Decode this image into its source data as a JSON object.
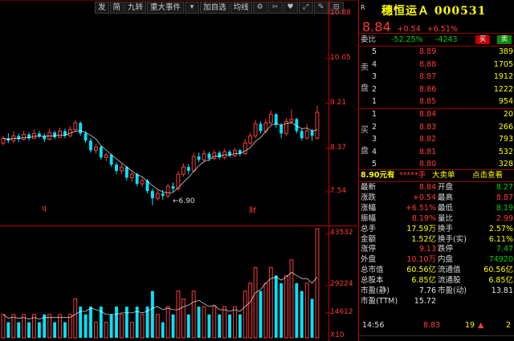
{
  "toolbar": {
    "items": [
      "发",
      "简",
      "九转",
      "重大事件",
      "▾",
      "加自选",
      "均线",
      "⚙",
      "✂",
      "♥",
      "⤢",
      "✎",
      "⊟"
    ]
  },
  "chart": {
    "price_axis": [
      "10.88",
      "10.05",
      "9.21",
      "8.37",
      "7.54"
    ],
    "volume_axis": [
      "43532",
      "29224",
      "14612",
      "X10"
    ],
    "low_marker": "6.90",
    "markers": [
      "q",
      "财"
    ],
    "colors": {
      "up": "#ff3b3b",
      "down": "#00e5ff",
      "ma": "#ffffff",
      "border": "#c00000"
    }
  },
  "chart_data": {
    "type": "candlestick",
    "ylim": [
      6.7,
      10.88
    ],
    "candles": [
      {
        "o": 8.2,
        "c": 8.3,
        "h": 8.35,
        "l": 8.15
      },
      {
        "o": 8.3,
        "c": 8.25,
        "h": 8.4,
        "l": 8.2
      },
      {
        "o": 8.25,
        "c": 8.35,
        "h": 8.45,
        "l": 8.2
      },
      {
        "o": 8.35,
        "c": 8.28,
        "h": 8.4,
        "l": 8.22
      },
      {
        "o": 8.28,
        "c": 8.38,
        "h": 8.45,
        "l": 8.25
      },
      {
        "o": 8.38,
        "c": 8.3,
        "h": 8.42,
        "l": 8.25
      },
      {
        "o": 8.3,
        "c": 8.4,
        "h": 8.48,
        "l": 8.28
      },
      {
        "o": 8.4,
        "c": 8.35,
        "h": 8.45,
        "l": 8.3
      },
      {
        "o": 8.35,
        "c": 8.28,
        "h": 8.4,
        "l": 8.22
      },
      {
        "o": 8.28,
        "c": 8.42,
        "h": 8.5,
        "l": 8.25
      },
      {
        "o": 8.42,
        "c": 8.32,
        "h": 8.46,
        "l": 8.28
      },
      {
        "o": 8.32,
        "c": 8.45,
        "h": 8.52,
        "l": 8.3
      },
      {
        "o": 8.45,
        "c": 8.35,
        "h": 8.5,
        "l": 8.3
      },
      {
        "o": 8.35,
        "c": 8.48,
        "h": 8.55,
        "l": 8.32
      },
      {
        "o": 8.48,
        "c": 8.62,
        "h": 8.68,
        "l": 8.45
      },
      {
        "o": 8.62,
        "c": 8.4,
        "h": 8.65,
        "l": 8.35
      },
      {
        "o": 8.4,
        "c": 8.25,
        "h": 8.45,
        "l": 8.2
      },
      {
        "o": 8.25,
        "c": 8.05,
        "h": 8.3,
        "l": 8.0
      },
      {
        "o": 8.05,
        "c": 8.12,
        "h": 8.18,
        "l": 7.98
      },
      {
        "o": 8.12,
        "c": 7.9,
        "h": 8.15,
        "l": 7.85
      },
      {
        "o": 7.9,
        "c": 7.95,
        "h": 8.0,
        "l": 7.82
      },
      {
        "o": 7.95,
        "c": 7.75,
        "h": 7.98,
        "l": 7.7
      },
      {
        "o": 7.75,
        "c": 7.62,
        "h": 7.8,
        "l": 7.55
      },
      {
        "o": 7.62,
        "c": 7.7,
        "h": 7.76,
        "l": 7.55
      },
      {
        "o": 7.7,
        "c": 7.48,
        "h": 7.72,
        "l": 7.42
      },
      {
        "o": 7.48,
        "c": 7.55,
        "h": 7.6,
        "l": 7.4
      },
      {
        "o": 7.55,
        "c": 7.35,
        "h": 7.58,
        "l": 7.3
      },
      {
        "o": 7.35,
        "c": 7.42,
        "h": 7.48,
        "l": 7.28
      },
      {
        "o": 7.42,
        "c": 7.2,
        "h": 7.45,
        "l": 7.15
      },
      {
        "o": 7.2,
        "c": 7.05,
        "h": 7.25,
        "l": 6.9
      },
      {
        "o": 7.05,
        "c": 7.15,
        "h": 7.22,
        "l": 7.0
      },
      {
        "o": 7.15,
        "c": 7.1,
        "h": 7.22,
        "l": 7.02
      },
      {
        "o": 7.1,
        "c": 7.3,
        "h": 7.35,
        "l": 7.05
      },
      {
        "o": 7.3,
        "c": 7.25,
        "h": 7.38,
        "l": 7.18
      },
      {
        "o": 7.25,
        "c": 7.55,
        "h": 7.62,
        "l": 7.2
      },
      {
        "o": 7.55,
        "c": 7.7,
        "h": 7.78,
        "l": 7.5
      },
      {
        "o": 7.7,
        "c": 7.62,
        "h": 7.76,
        "l": 7.55
      },
      {
        "o": 7.62,
        "c": 7.92,
        "h": 8.0,
        "l": 7.6
      },
      {
        "o": 7.92,
        "c": 7.85,
        "h": 8.0,
        "l": 7.8
      },
      {
        "o": 7.85,
        "c": 7.98,
        "h": 8.05,
        "l": 7.8
      },
      {
        "o": 7.98,
        "c": 7.88,
        "h": 8.02,
        "l": 7.82
      },
      {
        "o": 7.88,
        "c": 8.0,
        "h": 8.06,
        "l": 7.84
      },
      {
        "o": 8.0,
        "c": 7.9,
        "h": 8.04,
        "l": 7.86
      },
      {
        "o": 7.9,
        "c": 8.02,
        "h": 8.08,
        "l": 7.86
      },
      {
        "o": 8.02,
        "c": 7.94,
        "h": 8.06,
        "l": 7.9
      },
      {
        "o": 7.94,
        "c": 8.05,
        "h": 8.1,
        "l": 7.9
      },
      {
        "o": 8.05,
        "c": 7.98,
        "h": 8.08,
        "l": 7.92
      },
      {
        "o": 7.98,
        "c": 8.2,
        "h": 8.28,
        "l": 7.95
      },
      {
        "o": 8.2,
        "c": 8.35,
        "h": 8.42,
        "l": 8.15
      },
      {
        "o": 8.35,
        "c": 8.6,
        "h": 8.68,
        "l": 8.3
      },
      {
        "o": 8.6,
        "c": 8.45,
        "h": 8.65,
        "l": 8.4
      },
      {
        "o": 8.45,
        "c": 8.62,
        "h": 8.7,
        "l": 8.4
      },
      {
        "o": 8.62,
        "c": 8.8,
        "h": 8.88,
        "l": 8.58
      },
      {
        "o": 8.8,
        "c": 8.58,
        "h": 8.82,
        "l": 8.52
      },
      {
        "o": 8.58,
        "c": 8.4,
        "h": 8.62,
        "l": 8.3
      },
      {
        "o": 8.4,
        "c": 8.65,
        "h": 8.72,
        "l": 8.35
      },
      {
        "o": 8.65,
        "c": 8.7,
        "h": 8.9,
        "l": 8.6
      },
      {
        "o": 8.7,
        "c": 8.45,
        "h": 8.72,
        "l": 8.4
      },
      {
        "o": 8.45,
        "c": 8.3,
        "h": 8.5,
        "l": 8.25
      },
      {
        "o": 8.3,
        "c": 8.45,
        "h": 8.6,
        "l": 8.28
      },
      {
        "o": 8.45,
        "c": 8.35,
        "h": 8.5,
        "l": 8.25
      },
      {
        "o": 8.3,
        "c": 8.84,
        "h": 8.98,
        "l": 8.28
      }
    ],
    "volumes": [
      3,
      2,
      3,
      2,
      3,
      2,
      3,
      2,
      3,
      3,
      2,
      3,
      2,
      3,
      5,
      4,
      3,
      4,
      2,
      4,
      2,
      3,
      4,
      3,
      4,
      2,
      4,
      3,
      4,
      6,
      3,
      2,
      4,
      3,
      6,
      5,
      3,
      6,
      4,
      4,
      3,
      4,
      3,
      4,
      3,
      4,
      3,
      6,
      7,
      9,
      6,
      7,
      9,
      8,
      7,
      8,
      10,
      7,
      6,
      7,
      5,
      14
    ],
    "volume_max": 43532
  },
  "panel": {
    "badge": "R",
    "title": "穗恒运Ａ 000531",
    "price": "8.84",
    "change": "+0.54",
    "pct": "+6.51%",
    "weibi_label": "委比",
    "weibi_pct": "-52.25%",
    "weibi_diff": "-4243",
    "buy_btn": "买",
    "sell_btn": "卖",
    "sell_side_label": [
      "卖",
      "盘"
    ],
    "buy_side_label": [
      "买",
      "盘"
    ],
    "asks": [
      {
        "lvl": "5",
        "price": "8.89",
        "vol": "389"
      },
      {
        "lvl": "4",
        "price": "8.88",
        "vol": "1705"
      },
      {
        "lvl": "3",
        "price": "8.87",
        "vol": "1912"
      },
      {
        "lvl": "2",
        "price": "8.86",
        "vol": "1222"
      },
      {
        "lvl": "1",
        "price": "8.85",
        "vol": "954"
      }
    ],
    "bids": [
      {
        "lvl": "1",
        "price": "8.84",
        "vol": "20"
      },
      {
        "lvl": "2",
        "price": "8.83",
        "vol": "266"
      },
      {
        "lvl": "3",
        "price": "8.82",
        "vol": "793"
      },
      {
        "lvl": "4",
        "price": "8.81",
        "vol": "532"
      },
      {
        "lvl": "5",
        "price": "8.80",
        "vol": "328"
      }
    ],
    "ad": {
      "price": "8.90元有",
      "stars": "*****手",
      "text": "大卖单",
      "link": "点击查看"
    },
    "stats": [
      {
        "k1": "最新",
        "v1": "8.84",
        "c1": "red",
        "k2": "开盘",
        "v2": "8.27",
        "c2": "green"
      },
      {
        "k1": "涨跌",
        "v1": "+0.54",
        "c1": "red",
        "k2": "最高",
        "v2": "8.87",
        "c2": "red"
      },
      {
        "k1": "涨幅",
        "v1": "+6.51%",
        "c1": "red",
        "k2": "最低",
        "v2": "8.19",
        "c2": "green"
      },
      {
        "k1": "振幅",
        "v1": "8.19%",
        "c1": "red",
        "k2": "量比",
        "v2": "2.99",
        "c2": "red"
      },
      {
        "k1": "总手",
        "v1": "17.59万",
        "c1": "yellow",
        "k2": "换手",
        "v2": "2.57%",
        "c2": "yellow"
      },
      {
        "k1": "金额",
        "v1": "1.52亿",
        "c1": "yellow",
        "k2": "换手(实)",
        "v2": "6.11%",
        "c2": "yellow"
      },
      {
        "k1": "涨停",
        "v1": "9.13",
        "c1": "red",
        "k2": "跌停",
        "v2": "7.47",
        "c2": "green"
      },
      {
        "k1": "外盘",
        "v1": "10.10万",
        "c1": "red",
        "k2": "内盘",
        "v2": "74920",
        "c2": "green"
      },
      {
        "k1": "总市值",
        "v1": "60.56亿",
        "c1": "yellow",
        "k2": "流通值",
        "v2": "60.56亿",
        "c2": "yellow"
      },
      {
        "k1": "总股本",
        "v1": "6.85亿",
        "c1": "yellow",
        "k2": "流通股",
        "v2": "6.85亿",
        "c2": "yellow"
      },
      {
        "k1": "市盈(静)",
        "v1": "7.76",
        "c1": "white",
        "k2": "市盈(动)",
        "v2": "13.81",
        "c2": "white"
      },
      {
        "k1": "市盈(TTM)",
        "v1": "15.72",
        "c1": "white",
        "k2": "",
        "v2": "",
        "c2": "white"
      }
    ],
    "tick": {
      "time": "14:56",
      "price": "8.83",
      "vol": "19",
      "arrow": "▲",
      "num": "2"
    }
  }
}
